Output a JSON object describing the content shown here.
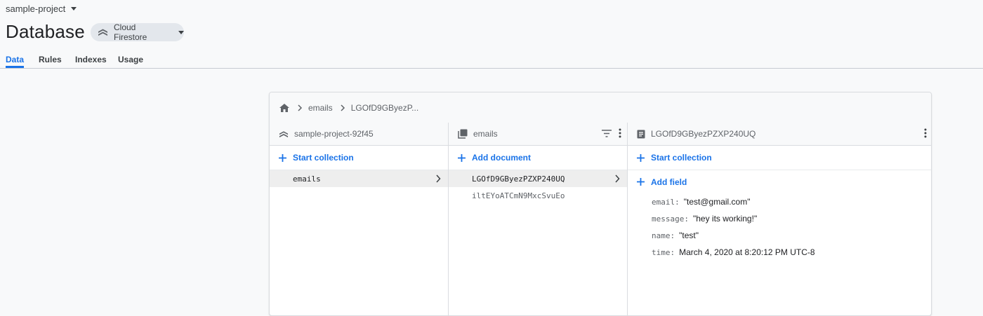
{
  "project": {
    "name": "sample-project"
  },
  "page": {
    "title": "Database"
  },
  "db_selector": {
    "label": "Cloud Firestore"
  },
  "tabs": [
    {
      "label": "Data",
      "active": true
    },
    {
      "label": "Rules",
      "active": false
    },
    {
      "label": "Indexes",
      "active": false
    },
    {
      "label": "Usage",
      "active": false
    }
  ],
  "breadcrumb": {
    "items": [
      "emails",
      "LGOfD9GByezP..."
    ]
  },
  "columns": {
    "root": {
      "title": "sample-project-92f45",
      "action": "Start collection",
      "items": [
        "emails"
      ]
    },
    "collection": {
      "title": "emails",
      "action": "Add document",
      "items": [
        "LGOfD9GByezPZXP240UQ",
        "iltEYoATCmN9MxcSvuEo"
      ]
    },
    "document": {
      "title": "LGOfD9GByezPZXP240UQ",
      "action": "Start collection",
      "add_field": "Add field",
      "fields": [
        {
          "key": "email:",
          "value": "\"test@gmail.com\""
        },
        {
          "key": "message:",
          "value": "\"hey its working!\""
        },
        {
          "key": "name:",
          "value": "\"test\""
        },
        {
          "key": "time:",
          "value": "March 4, 2020 at 8:20:12 PM UTC-8"
        }
      ]
    }
  },
  "colors": {
    "accent": "#1a73e8",
    "selected_row": "#eeeeee"
  }
}
